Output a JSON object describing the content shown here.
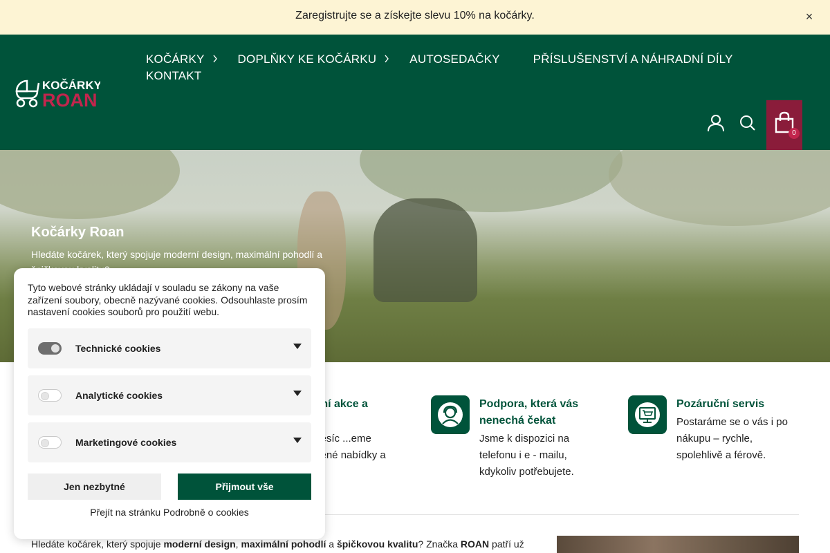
{
  "promo": {
    "text": "Zaregistrujte se a získejte slevu 10% na kočárky.",
    "close_symbol": "×"
  },
  "header": {
    "logo": {
      "line1": "KOČÁRKY",
      "line2": "ROAN",
      "icon": "stroller-icon"
    },
    "nav": [
      {
        "label": "KOČÁRKY",
        "has_dropdown": true
      },
      {
        "label": "DOPLŇKY KE KOČÁRKU",
        "has_dropdown": true
      },
      {
        "label": "AUTOSEDAČKY",
        "has_dropdown": false
      },
      {
        "label": "PŘÍSLUŠENSTVÍ A NÁHRADNÍ DÍLY",
        "has_dropdown": false
      },
      {
        "label": "KONTAKT",
        "has_dropdown": false
      }
    ],
    "cart_count": "0",
    "colors": {
      "header_bg": "#00533a",
      "cart_bg": "#8a1c3a",
      "promo_bg": "#fdf4d4"
    }
  },
  "hero": {
    "title": "Kočárky Roan",
    "subtitle": "Hledáte kočárek, který spojuje moderní design, maximální pohodlí a špičkovou kvalitu?"
  },
  "features": [
    {
      "title": "...ní akce a",
      "text": "...ěsíc ...eme ...ené nabídky a",
      "icon": "gift-icon"
    },
    {
      "title": "Podpora, která vás nenechá čekat",
      "text": "Jsme k dispozici na telefonu i e - mailu, kdykoliv potřebujete.",
      "icon": "support-agent-icon"
    },
    {
      "title": "Pozáruční servis",
      "text": "Postaráme se o vás i po nákupu – rychle, spolehlivě a férově.",
      "icon": "service-cart-icon"
    }
  ],
  "intro": {
    "p1": "Hledáte kočárek, který spojuje ",
    "b1": "moderní design",
    "p2": ", ",
    "b2": "maximální pohodlí",
    "p3": " a ",
    "b3": "špičkovou kvalitu",
    "p4": "? Značka ",
    "b4": "ROAN",
    "p5": " patří už"
  },
  "cookie": {
    "text": "Tyto webové stránky ukládají v souladu se zákony na vaše zařízení soubory, obecně nazývané cookies. Odsouhlaste prosím nastavení cookies souborů pro použití webu.",
    "categories": [
      {
        "label": "Technické cookies",
        "enabled": true
      },
      {
        "label": "Analytické cookies",
        "enabled": false
      },
      {
        "label": "Marketingové cookies",
        "enabled": false
      }
    ],
    "btn_necessary": "Jen nezbytné",
    "btn_accept": "Přijmout vše",
    "link": "Přejít na stránku Podrobně o cookies"
  }
}
